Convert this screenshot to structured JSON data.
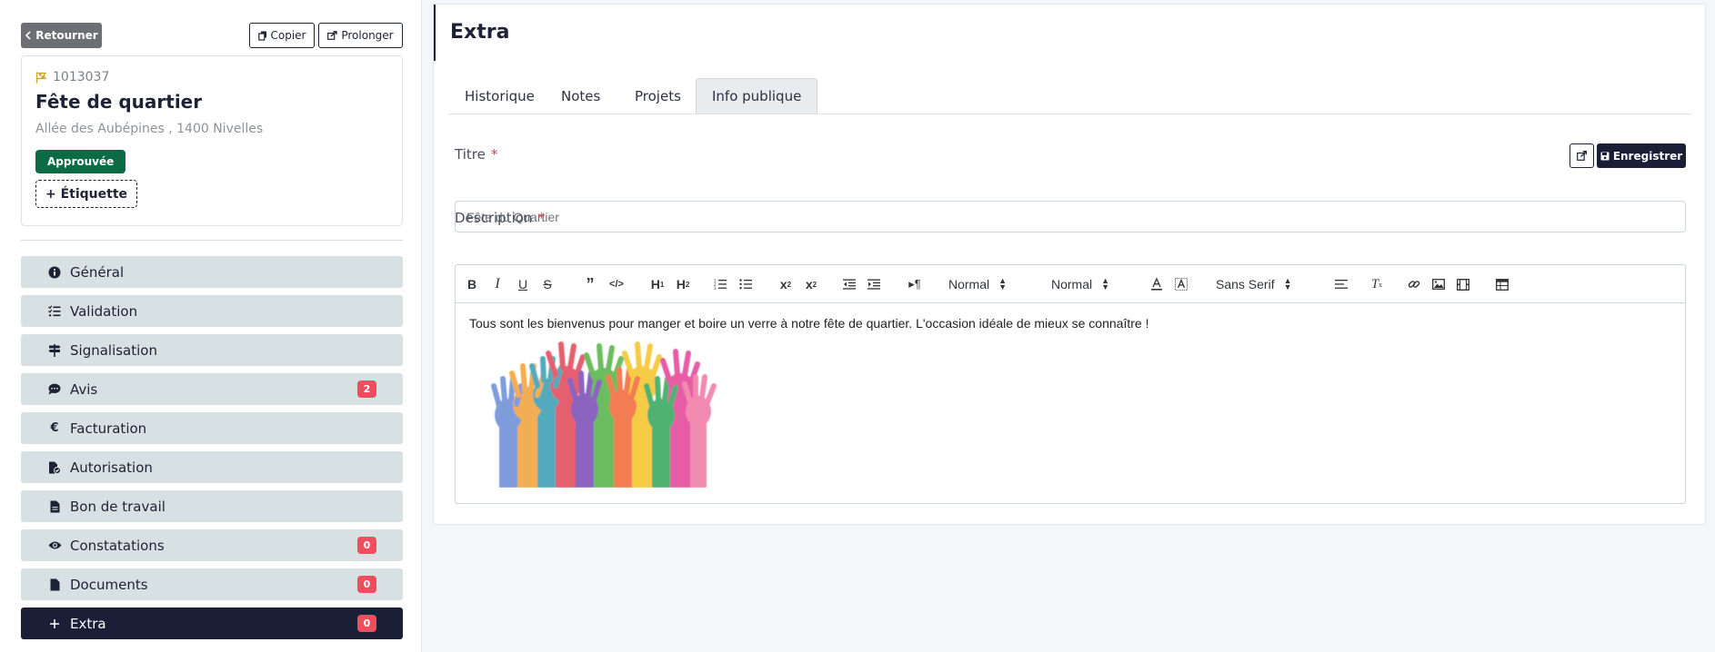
{
  "header": {
    "back_label": "Retourner",
    "copy_label": "Copier",
    "extend_label": "Prolonger"
  },
  "case": {
    "reference": "1013037",
    "title": "Fête de quartier",
    "address": "Allée des Aubépines , 1400 Nivelles",
    "status": "Approuvée",
    "add_label": "+ Étiquette"
  },
  "nav": {
    "items": [
      {
        "label": "Général",
        "icon": "info-circle-icon"
      },
      {
        "label": "Validation",
        "icon": "checklist-icon"
      },
      {
        "label": "Signalisation",
        "icon": "signpost-icon"
      },
      {
        "label": "Avis",
        "icon": "chat-bubble-icon",
        "count": "2"
      },
      {
        "label": "Facturation",
        "icon": "euro-icon"
      },
      {
        "label": "Autorisation",
        "icon": "file-check-icon"
      },
      {
        "label": "Bon de travail",
        "icon": "file-icon"
      },
      {
        "label": "Constatations",
        "icon": "eye-icon",
        "count": "0"
      },
      {
        "label": "Documents",
        "icon": "file-icon",
        "count": "0"
      },
      {
        "label": "Extra",
        "icon": "plus-icon",
        "count": "0",
        "active": true
      }
    ]
  },
  "main": {
    "section_title": "Extra",
    "tabs": [
      {
        "label": "Historique"
      },
      {
        "label": "Notes"
      },
      {
        "label": "Projets"
      },
      {
        "label": "Info publique",
        "active": true
      }
    ],
    "save_label": "Enregistrer",
    "title_label": "Titre",
    "title_value": "Fête du Quartier",
    "description_label": "Description",
    "required_marker": "*",
    "editor": {
      "header_select": "Normal",
      "size_select": "Normal",
      "font_select": "Sans Serif",
      "content": "Tous sont les bienvenus pour manger et boire un verre à notre fête de quartier. L'occasion idéale de mieux se connaître !"
    }
  },
  "colors": {
    "primary": "#1a1e37",
    "nav_bg": "#d7e0e2",
    "approved": "#0a6b45",
    "badge": "#f04e5e",
    "required": "#e0364a"
  }
}
